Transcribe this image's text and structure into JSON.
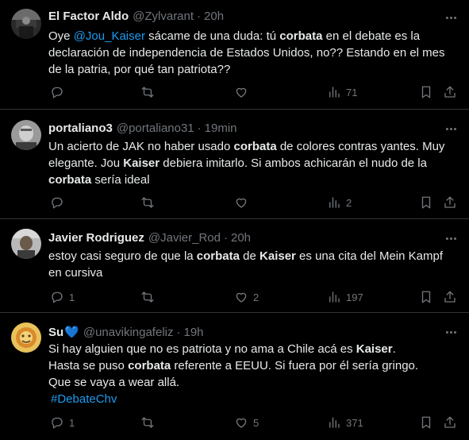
{
  "tweets": [
    {
      "name": "El Factor Aldo",
      "handle": "@Zylvarant",
      "time": "20h",
      "text": {
        "l1a": "Oye ",
        "l1mention": "@Jou_Kaiser",
        "l1b": " sácame de una duda: tú ",
        "l1kw": "corbata",
        "l1c": " en el debate es la",
        "l2": "declaración de independencia de Estados Unidos, no?? Estando en el mes",
        "l3": "de la patria, por qué tan patriota??"
      },
      "counts": {
        "replies": "",
        "retweets": "",
        "likes": "",
        "views": "71"
      }
    },
    {
      "name": "portaliano3",
      "handle": "@portaliano31",
      "time": "19min",
      "text": {
        "l1a": "Un acierto de JAK no haber usado ",
        "l1kw": "corbata",
        "l1b": " de colores contras yantes. Muy",
        "l2a": "elegante. Jou ",
        "l2kw": "Kaiser",
        "l2b": " debiera imitarlo. Si ambos achicarán el nudo de la",
        "l3kw": "corbata",
        "l3b": " sería ideal"
      },
      "counts": {
        "replies": "",
        "retweets": "",
        "likes": "",
        "views": "2"
      }
    },
    {
      "name": "Javier Rodriguez",
      "handle": "@Javier_Rod",
      "time": "20h",
      "text": {
        "l1a": "estoy casi seguro de que la ",
        "l1kw": "corbata",
        "l1b": " de ",
        "l1kw2": "Kaiser",
        "l1c": " es una cita del Mein Kampf",
        "l2": "en cursiva"
      },
      "counts": {
        "replies": "1",
        "retweets": "",
        "likes": "2",
        "views": "197"
      }
    },
    {
      "name": "Su",
      "name_emoji": "💙",
      "handle": "@unavikingafeliz",
      "time": "19h",
      "text": {
        "l1a": "Si hay alguien que no es patriota y no ama a Chile acá es ",
        "l1kw": "Kaiser",
        "l1b": ".",
        "l2a": "Hasta se puso ",
        "l2kw": "corbata",
        "l2b": " referente a EEUU. Si fuera por él sería gringo.",
        "l3": "Que se vaya a wear allá.",
        "l4hashtag": "#DebateChv"
      },
      "counts": {
        "replies": "1",
        "retweets": "",
        "likes": "5",
        "views": "371"
      }
    }
  ],
  "icons": {
    "reply": "reply-icon",
    "retweet": "retweet-icon",
    "like": "heart-icon",
    "views": "views-icon",
    "bookmark": "bookmark-icon",
    "share": "share-icon",
    "more": "more-icon"
  },
  "colors": {
    "background": "#000000",
    "text": "#e7e9ea",
    "muted": "#71767b",
    "link": "#1d9bf0",
    "divider": "#2f3336",
    "heart_emoji": "#1d9bf0"
  }
}
